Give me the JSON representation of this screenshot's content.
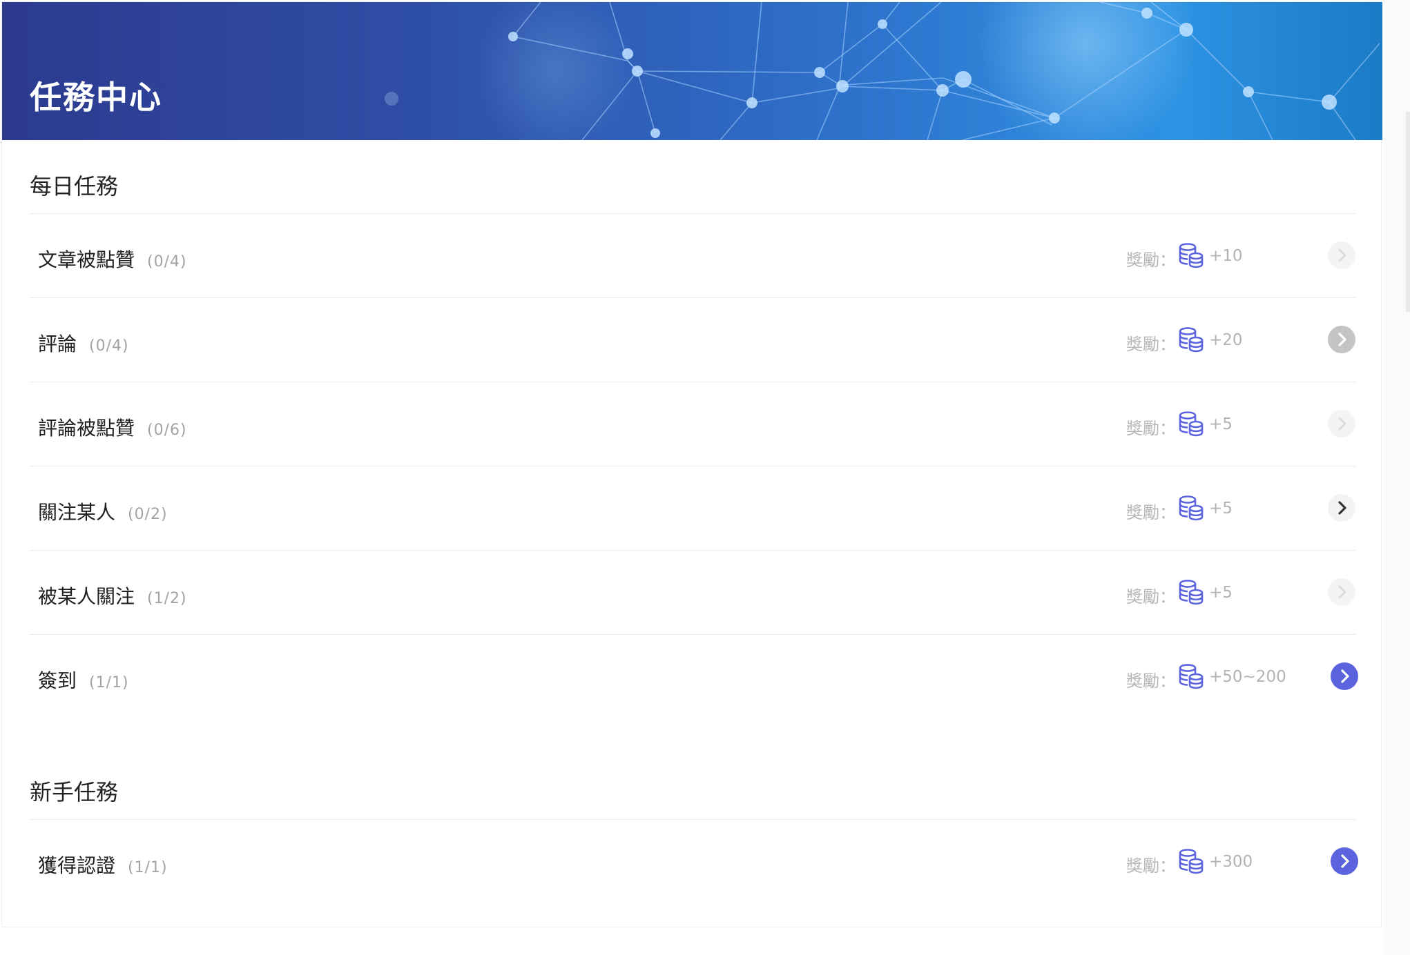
{
  "header": {
    "title": "任務中心"
  },
  "reward_prefix": "獎勵：",
  "colors": {
    "banner_start": "#2c3a8e",
    "banner_end": "#2d93e3",
    "coin_icon": "#5b63df",
    "go_active": "#5b63df",
    "go_inactive": "#c4c4c4"
  },
  "sections": [
    {
      "title": "每日任務",
      "tasks": [
        {
          "name": "文章被點贊",
          "progress": "(0/4)",
          "reward": "+10",
          "button_state": "disabled"
        },
        {
          "name": "評論",
          "progress": "(0/4)",
          "reward": "+20",
          "button_state": "inactive"
        },
        {
          "name": "評論被點贊",
          "progress": "(0/6)",
          "reward": "+5",
          "button_state": "disabled"
        },
        {
          "name": "關注某人",
          "progress": "(0/2)",
          "reward": "+5",
          "button_state": "plain"
        },
        {
          "name": "被某人關注",
          "progress": "(1/2)",
          "reward": "+5",
          "button_state": "disabled"
        },
        {
          "name": "簽到",
          "progress": "(1/1)",
          "reward": "+50~200",
          "button_state": "active"
        }
      ]
    },
    {
      "title": "新手任務",
      "tasks": [
        {
          "name": "獲得認證",
          "progress": "(1/1)",
          "reward": "+300",
          "button_state": "active"
        }
      ]
    }
  ]
}
